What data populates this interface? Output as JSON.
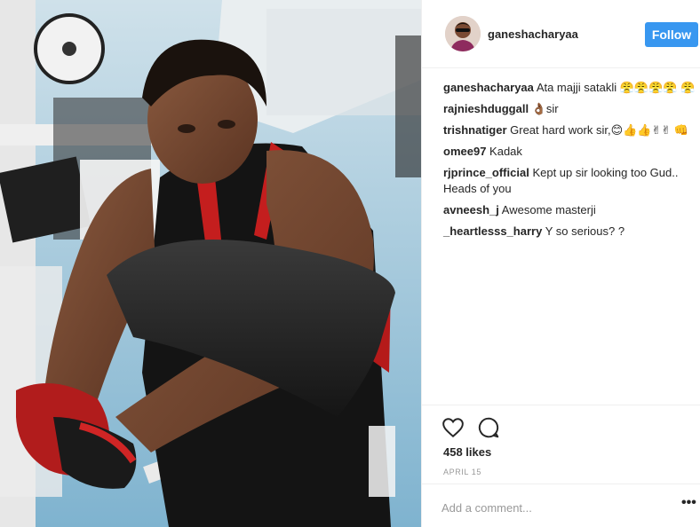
{
  "post": {
    "username": "ganeshacharyaa",
    "follow_label": "Follow",
    "comments": [
      {
        "user": "ganeshacharyaa",
        "text": "Ata majji satakli 😤😤😤😤 😤"
      },
      {
        "user": "rajnieshduggall",
        "text": "👌🏾sir"
      },
      {
        "user": "trishnatiger",
        "text": "Great hard work sir,😊👍👍✌✌ 👊"
      },
      {
        "user": "omee97",
        "text": "Kadak"
      },
      {
        "user": "rjprince_official",
        "text": "Kept up sir looking too Gud.. Heads of you"
      },
      {
        "user": "avneesh_j",
        "text": "Awesome masterji"
      },
      {
        "user": "_heartlesss_harry",
        "text": "Y so serious? ?"
      }
    ],
    "likes": "458 likes",
    "date": "APRIL 15",
    "comment_placeholder": "Add a comment...",
    "more_label": "•••"
  },
  "icons": {
    "like": "heart-icon",
    "comment": "comment-bubble-icon",
    "more": "ellipsis-icon"
  },
  "colors": {
    "follow_bg": "#3897f0",
    "divider": "#efefef",
    "muted": "#999999"
  }
}
